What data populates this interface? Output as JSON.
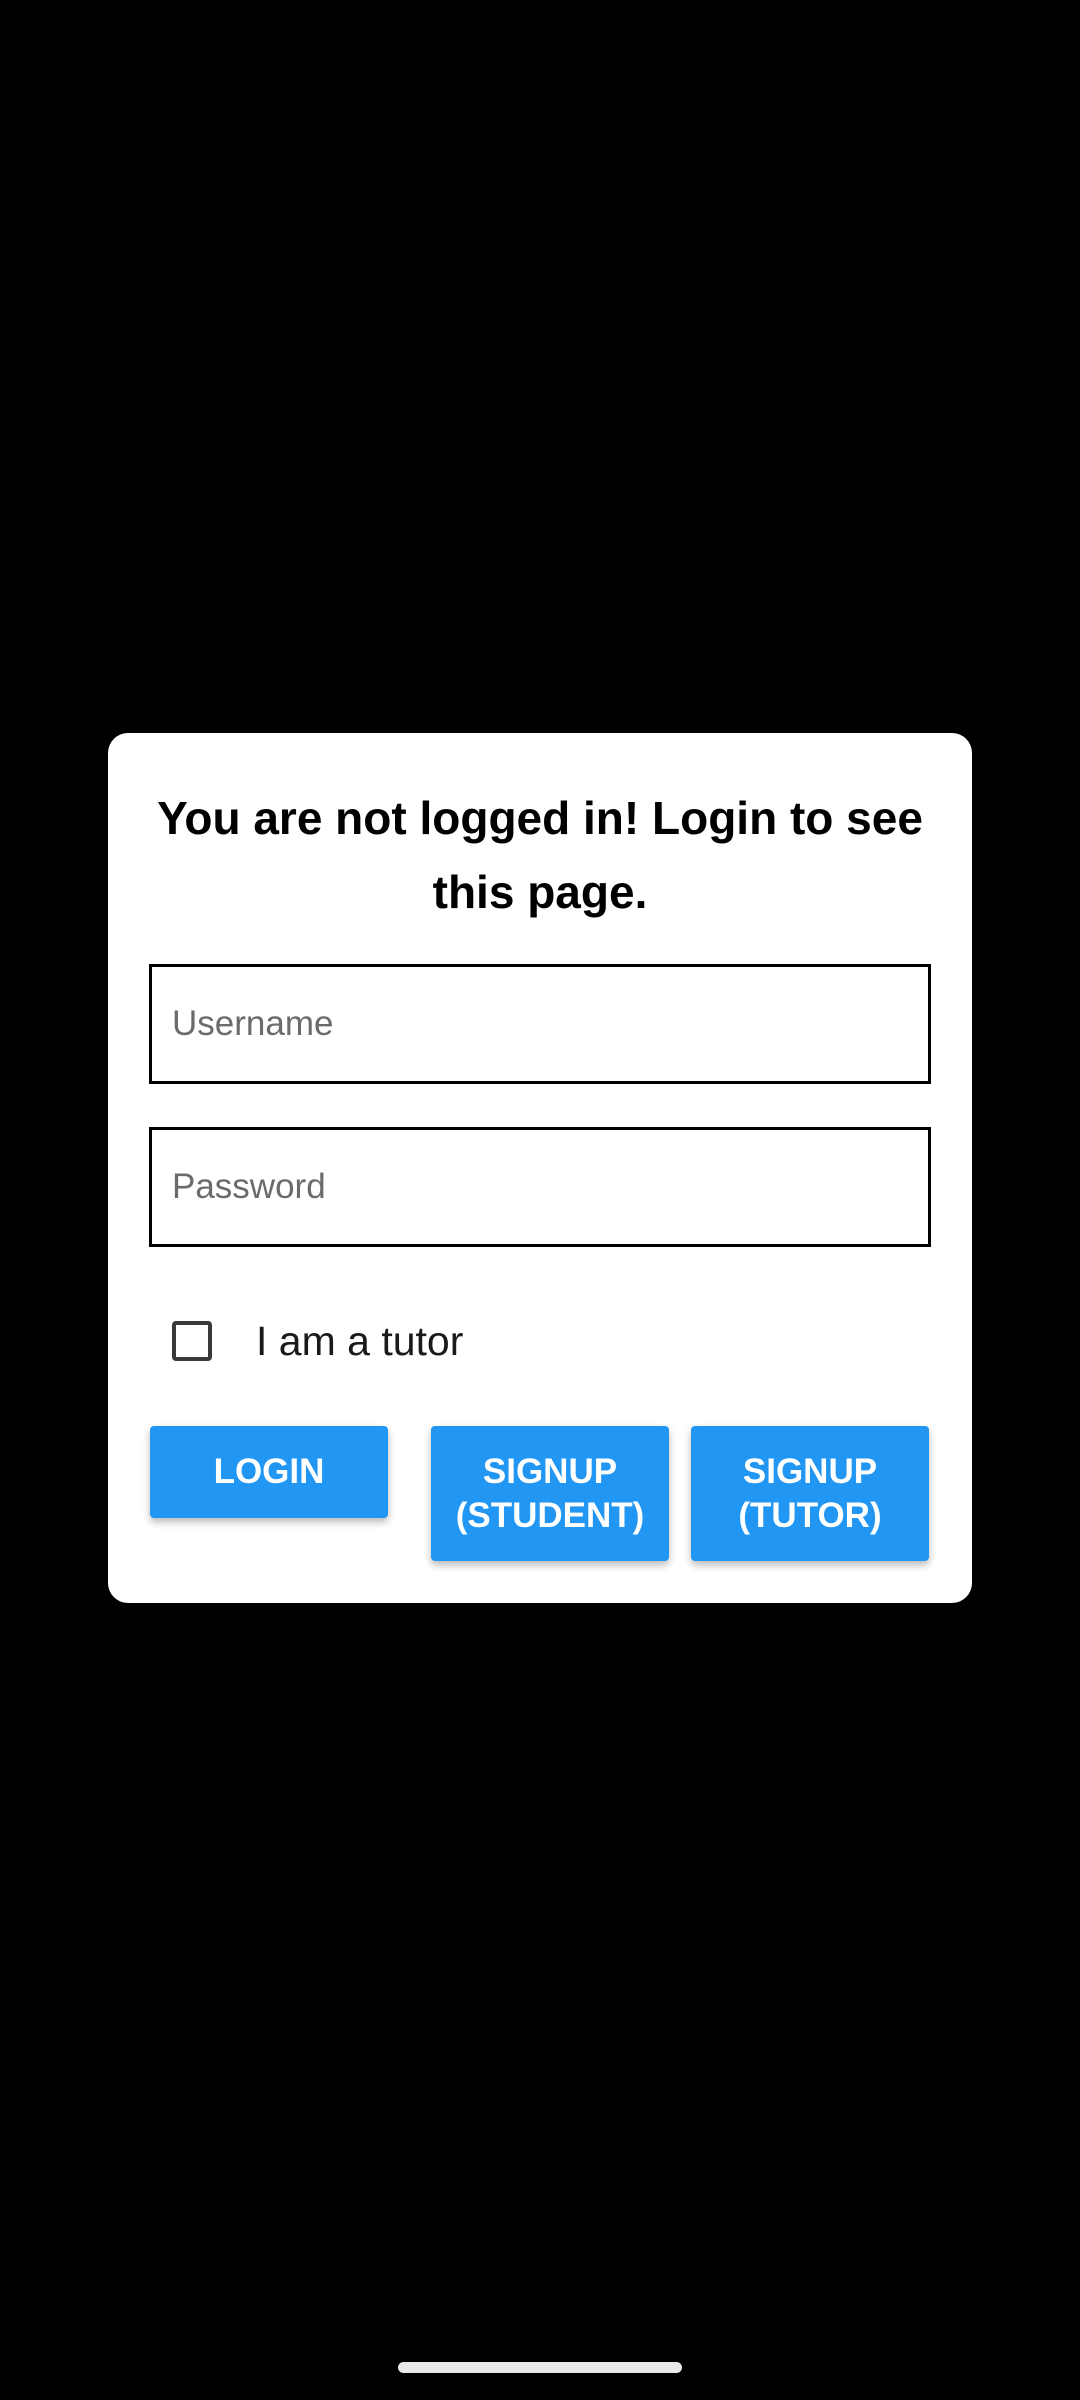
{
  "dialog": {
    "title": "You are not logged in! Login to see this page.",
    "username": {
      "placeholder": "Username",
      "value": ""
    },
    "password": {
      "placeholder": "Password",
      "value": ""
    },
    "tutor_checkbox": {
      "label": "I am a tutor",
      "checked": false
    },
    "buttons": {
      "login": "LOGIN",
      "signup_student": "SIGNUP\n(STUDENT)",
      "signup_tutor": "SIGNUP\n(TUTOR)"
    }
  },
  "colors": {
    "background": "#000000",
    "dialog_background": "#ffffff",
    "button_primary": "#2196f3",
    "button_text": "#ffffff"
  }
}
